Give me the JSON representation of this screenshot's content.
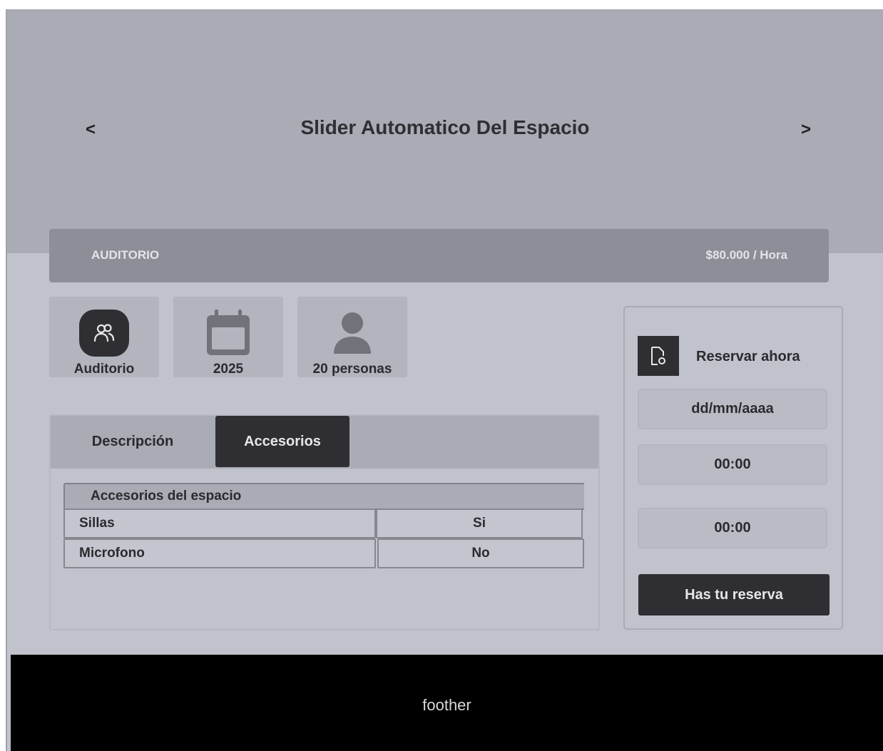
{
  "slider": {
    "title": "Slider Automatico Del Espacio",
    "prev_label": "<",
    "next_label": ">"
  },
  "space": {
    "type_label": "AUDITORIO",
    "price": "$80.000 / Hora"
  },
  "features": [
    {
      "icon": "users-icon",
      "label": "Auditorio"
    },
    {
      "icon": "calendar-icon",
      "label": "2025"
    },
    {
      "icon": "person-icon",
      "label": "20 personas"
    }
  ],
  "tabs": [
    {
      "label": "Descripción",
      "active": false
    },
    {
      "label": "Accesorios",
      "active": true
    }
  ],
  "accessories": {
    "header": "Accesorios del espacio",
    "rows": [
      {
        "name": "Sillas",
        "value": "Si"
      },
      {
        "name": "Microfono",
        "value": "No"
      }
    ]
  },
  "booking": {
    "icon": "document-settings-icon",
    "title": "Reservar ahora",
    "date_placeholder": "dd/mm/aaaa",
    "start_time_value": "00:00",
    "end_time_value": "00:00",
    "submit_label": "Has tu reserva"
  },
  "footer": {
    "text": "foother"
  },
  "colors": {
    "dark": "#2f2f33",
    "header_bar": "#8c8f97",
    "slider_bg": "#a9acb5",
    "page_bg": "#c0c3cc",
    "footer_bg": "#000000"
  }
}
